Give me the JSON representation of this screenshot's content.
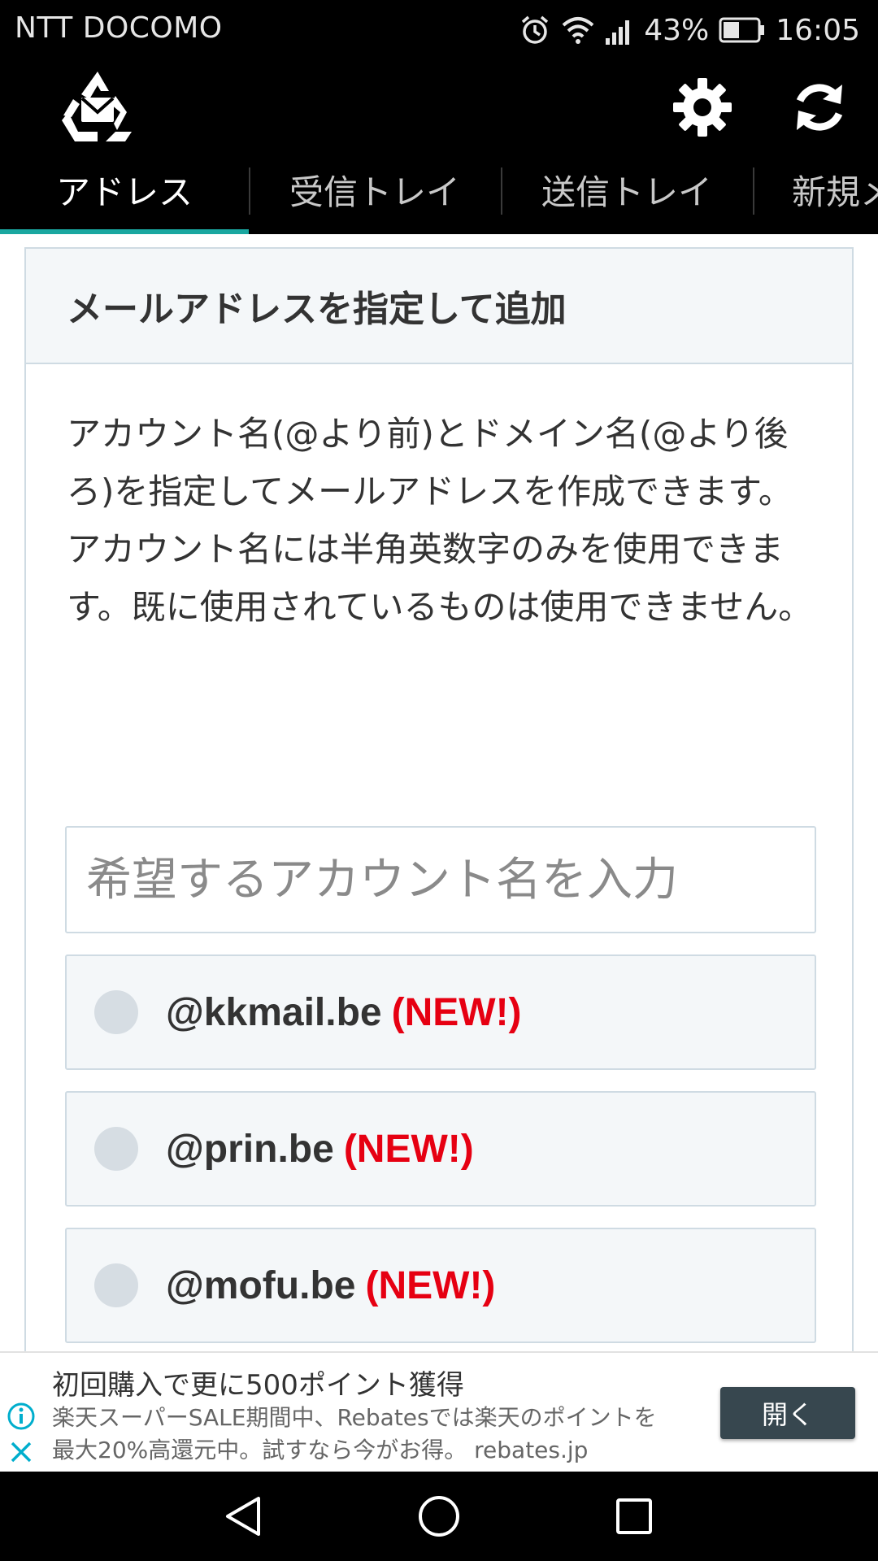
{
  "status_bar": {
    "carrier": "NTT DOCOMO",
    "battery_percent": "43%",
    "time": "16:05",
    "icons": [
      "alarm-icon",
      "wifi-icon",
      "signal-icon",
      "battery-icon"
    ]
  },
  "app_bar": {
    "icons": [
      "app-logo-icon",
      "gear-icon",
      "refresh-icon"
    ]
  },
  "tabs": {
    "items": [
      {
        "label": "アドレス",
        "active": true
      },
      {
        "label": "受信トレイ",
        "active": false
      },
      {
        "label": "送信トレイ",
        "active": false
      },
      {
        "label": "新規メール",
        "active": false
      }
    ],
    "accent_color": "#1aa7a0"
  },
  "card": {
    "title": "メールアドレスを指定して追加",
    "description_1": "アカウント名(@より前)とドメイン名(@より後ろ)を指定してメールアドレスを作成できます。",
    "description_2": "アカウント名には半角英数字のみを使用できます。既に使用されているものは使用できません。",
    "account_input": {
      "value": "",
      "placeholder": "希望するアカウント名を入力"
    },
    "domains": [
      {
        "domain": "@kkmail.be",
        "badge": "(NEW!)",
        "selected": false
      },
      {
        "domain": "@prin.be",
        "badge": "(NEW!)",
        "selected": false
      },
      {
        "domain": "@mofu.be",
        "badge": "(NEW!)",
        "selected": false
      }
    ],
    "badge_color": "#e60012"
  },
  "ad": {
    "title": "初回購入で更に500ポイント獲得",
    "body": "楽天スーパーSALE期間中、Rebatesでは楽天のポイントを\n最大20%高還元中。試すなら今がお得。 rebates.jp",
    "button_label": "開く"
  },
  "nav_bar": {
    "icons": [
      "back-icon",
      "home-icon",
      "recents-icon"
    ]
  }
}
